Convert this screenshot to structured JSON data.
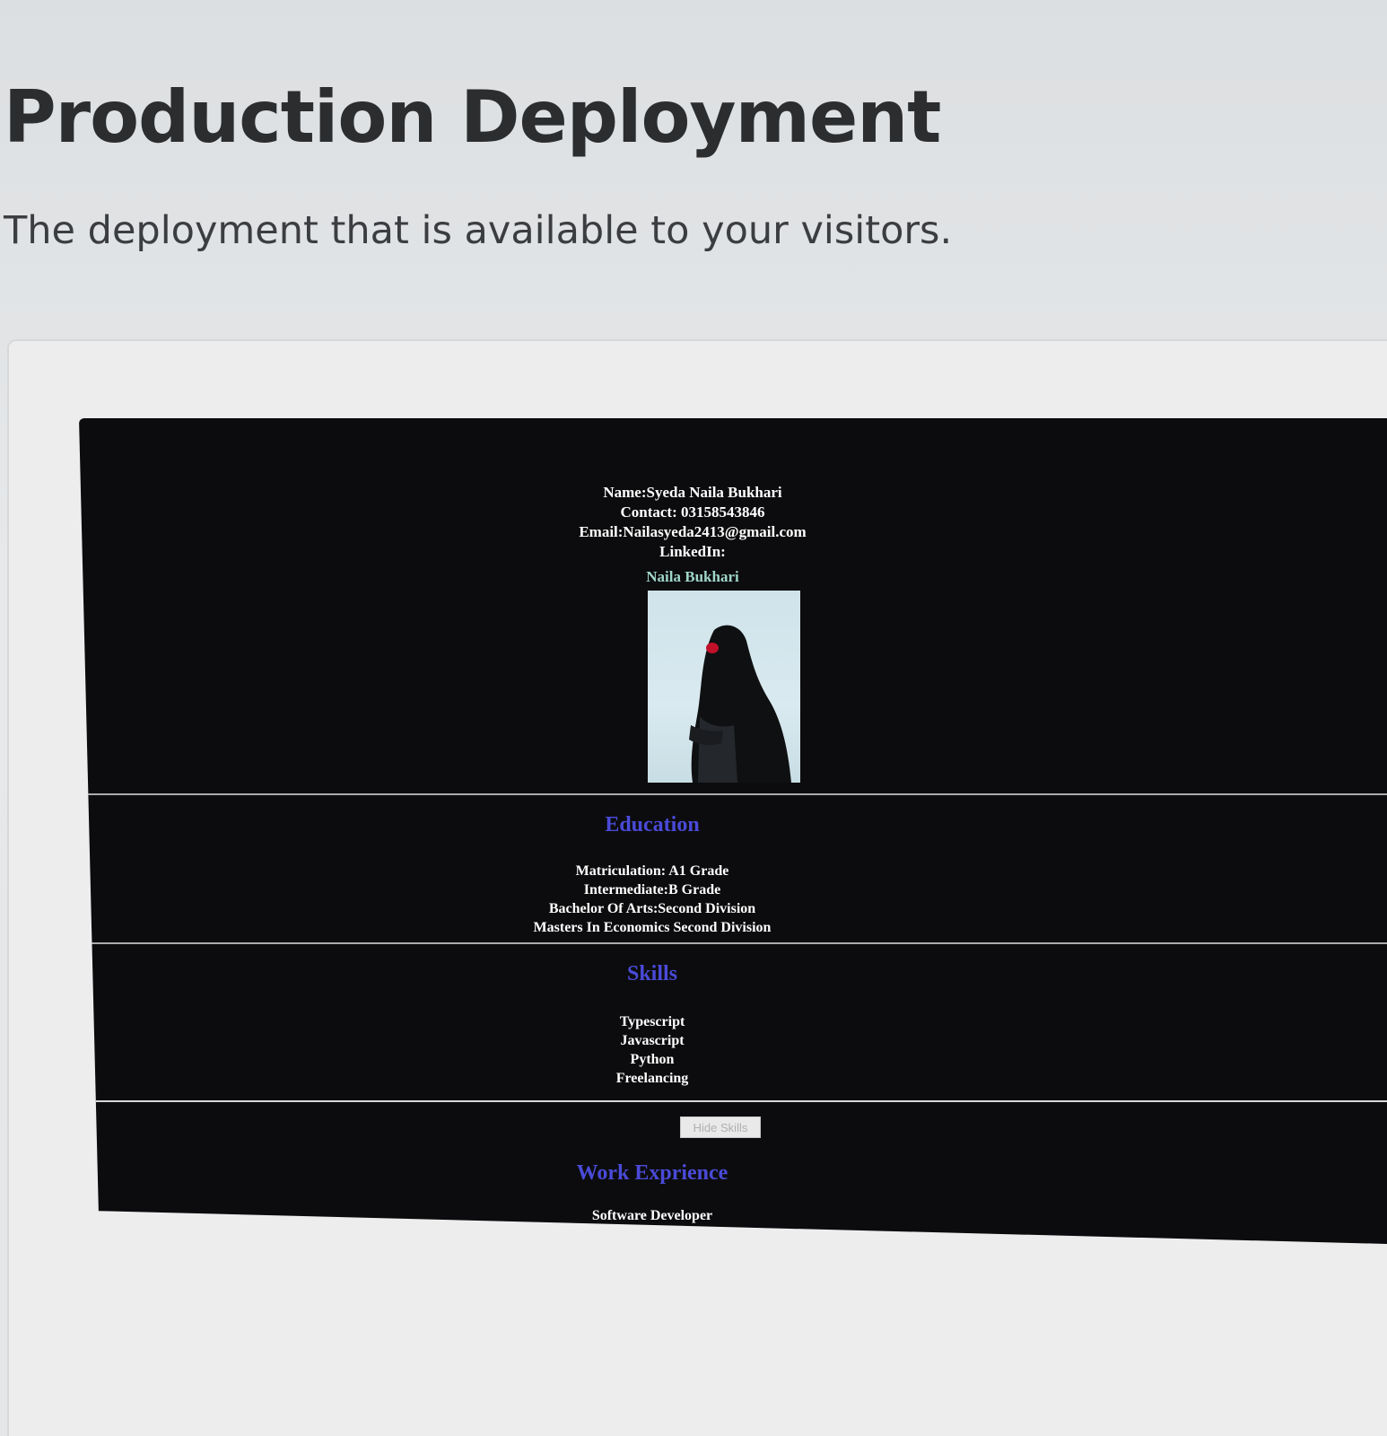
{
  "header": {
    "title": "Production Deployment",
    "subtitle": "The deployment that is available to your visitors."
  },
  "site": {
    "profile": {
      "name": "Name:Syeda Naila Bukhari",
      "contact": "Contact: 03158543846",
      "email": "Email:Nailasyeda2413@gmail.com",
      "linkedin_label": "LinkedIn:",
      "linkedin_link": "Naila Bukhari"
    },
    "education": {
      "title": "Education",
      "items": [
        "Matriculation: A1 Grade",
        "Intermediate:B Grade",
        "Bachelor Of Arts:Second Division",
        "Masters In Economics Second Division"
      ]
    },
    "skills": {
      "title": "Skills",
      "items": [
        "Typescript",
        "Javascript",
        "Python",
        "Freelancing"
      ]
    },
    "toggle_button": "Hide Skills",
    "work": {
      "title": "Work Exprience",
      "items": [
        "Software Developer"
      ]
    }
  }
}
